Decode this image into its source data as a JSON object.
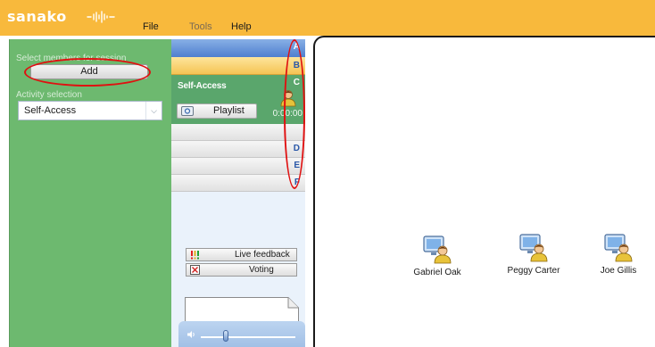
{
  "app": {
    "logo_text": "sanako",
    "brand_color": "#f8b93c"
  },
  "menu": {
    "file": "File",
    "tools": "Tools",
    "help": "Help"
  },
  "left_panel": {
    "select_members_label": "Select members for session",
    "add_button": "Add",
    "activity_label": "Activity selection",
    "activity_value": "Self-Access",
    "panel_color": "#6db96f"
  },
  "channels": {
    "letters": [
      "A",
      "B",
      "C",
      "D",
      "E",
      "F"
    ],
    "active_activity": "Self-Access",
    "playlist_button": "Playlist",
    "timer": "0:00:00"
  },
  "tools": {
    "live_feedback": "Live feedback",
    "voting": "Voting"
  },
  "students": [
    {
      "name": "Gabriel Oak"
    },
    {
      "name": "Peggy Carter"
    },
    {
      "name": "Joe Gillis"
    }
  ],
  "annotation_color": "#e01010"
}
